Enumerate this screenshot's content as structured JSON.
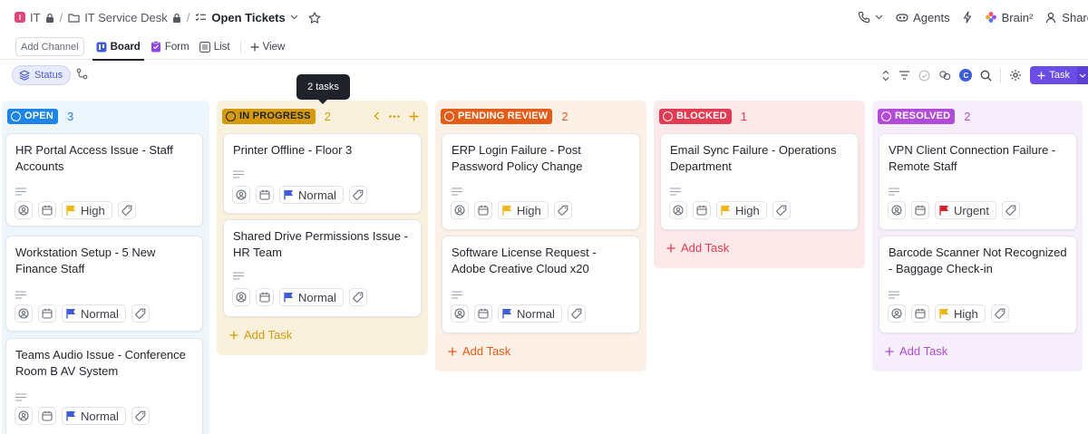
{
  "breadcrumb": {
    "space_initial": "I",
    "space": "IT",
    "folder": "IT Service Desk",
    "list": "Open Tickets"
  },
  "topbar": {
    "agents": "Agents",
    "brain": "Brain²",
    "share": "Share"
  },
  "views": {
    "add_channel": "Add Channel",
    "tabs": [
      {
        "label": "Board",
        "icon": "board-icon",
        "active": true
      },
      {
        "label": "Form",
        "icon": "form-icon",
        "active": false
      },
      {
        "label": "List",
        "icon": "list-icon",
        "active": false
      }
    ],
    "add_view": "View"
  },
  "filters": {
    "group_by": "Status",
    "avatar_initial": "C",
    "new_task": "Task"
  },
  "tooltip": "2 tasks",
  "add_task_label": "Add Task",
  "colors": {
    "accent": "#6b4de6",
    "open": "#1e85e6",
    "in_progress": "#d59a0a",
    "pending_review": "#e35c17",
    "blocked": "#e33b52",
    "resolved": "#b34bd9",
    "flag_high": "#f3b516",
    "flag_normal": "#3e5bd8",
    "flag_urgent": "#d6222b"
  },
  "columns": [
    {
      "status": "OPEN",
      "count": "3",
      "tasks": [
        {
          "title": "HR Portal Access Issue - Staff Accounts",
          "priority": "High"
        },
        {
          "title": "Workstation Setup - 5 New Finance Staff",
          "priority": "Normal"
        },
        {
          "title": "Teams Audio Issue - Conference Room B AV System",
          "priority": "Normal"
        }
      ]
    },
    {
      "status": "IN PROGRESS",
      "count": "2",
      "tasks": [
        {
          "title": "Printer Offline - Floor 3",
          "priority": "Normal"
        },
        {
          "title": "Shared Drive Permissions Issue - HR Team",
          "priority": "Normal"
        }
      ]
    },
    {
      "status": "PENDING REVIEW",
      "count": "2",
      "tasks": [
        {
          "title": "ERP Login Failure - Post Password Policy Change",
          "priority": "High"
        },
        {
          "title": "Software License Request - Adobe Creative Cloud x20",
          "priority": "Normal"
        }
      ]
    },
    {
      "status": "BLOCKED",
      "count": "1",
      "tasks": [
        {
          "title": "Email Sync Failure - Operations Department",
          "priority": "High"
        }
      ]
    },
    {
      "status": "RESOLVED",
      "count": "2",
      "tasks": [
        {
          "title": "VPN Client Connection Failure - Remote Staff",
          "priority": "Urgent"
        },
        {
          "title": "Barcode Scanner Not Recognized - Baggage Check-in",
          "priority": "High"
        }
      ]
    }
  ]
}
